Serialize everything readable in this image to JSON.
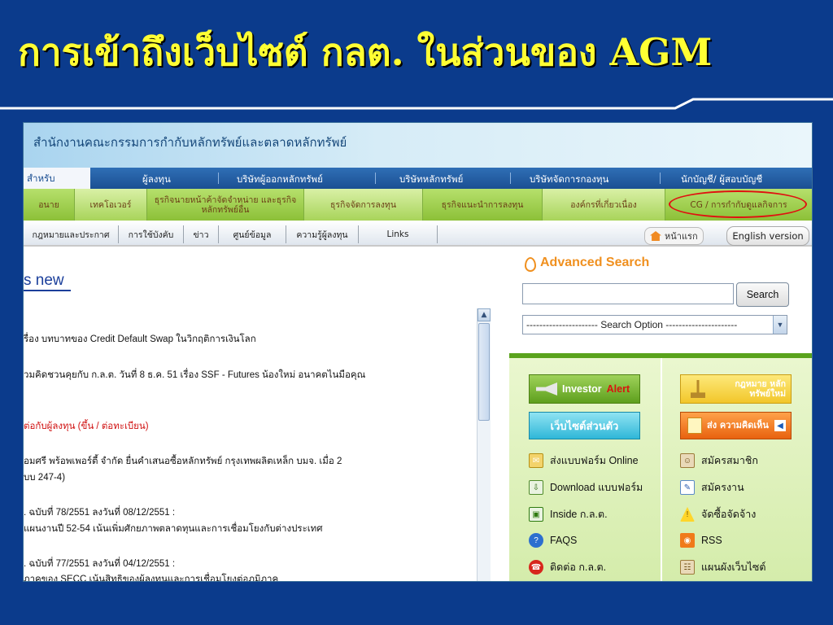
{
  "slide": {
    "title": "การเข้าถึงเว็บไซต์ กลต. ในส่วนของ AGM"
  },
  "site": {
    "banner_title": "สำนักงานคณะกรรมการกำกับหลักทรัพย์และตลาดหลักทรัพย์",
    "nav_primary": [
      "สำหรับ",
      "ผู้ลงทุน",
      "บริษัทผู้ออกหลักทรัพย์",
      "บริษัทหลักทรัพย์",
      "บริษัทจัดการกองทุน",
      "นักบัญชี/ ผู้สอบบัญชี"
    ],
    "nav_secondary": [
      "อนาย",
      "เทคโอเวอร์",
      "ธุรกิจนายหน้าค้าจัดจำหน่าย และธุรกิจหลักทรัพย์อื่น",
      "ธุรกิจจัดการลงทุน",
      "ธุรกิจแนะนำการลงทุน",
      "องค์กรที่เกี่ยวเนื่อง",
      "CG / การกำกับดูแลกิจการ"
    ],
    "nav_tertiary": [
      "กฎหมายและประกาศ",
      "การใช้บังคับ",
      "ข่าว",
      "ศูนย์ข้อมูล",
      "ความรู้ผู้ลงทุน",
      "Links"
    ],
    "home_label": "หน้าแรก",
    "english_label": "English version"
  },
  "news": {
    "heading": "s new",
    "items": [
      "รื่อง บทบาทของ Credit Default Swap ในวิกฤติการเงินโลก",
      "วมคิดชวนคุยกับ ก.ล.ต. วันที่ 8 ธ.ค. 51 เรื่อง SSF - Futures น้องใหม่ อนาคตไนมือคุณ",
      "ต่อกับผู้ลงทุน (ขึ้น / ต่อทะเบียน)",
      "อมศรี พร้อพเพอร์ตี้ จำกัด ยื่นคำเสนอซื้อหลักทรัพย์ กรุงเทพผลิตเหล็ก บมจ. เมื่อ 2",
      "บบ 247-4)",
      ". ฉบับที่ 78/2551 ลงวันที่ 08/12/2551 :",
      "แผนงานปี 52-54 เน้นเพิ่มศักยภาพตลาดทุนและการเชื่อมโยงกับต่างประเทศ",
      ". ฉบับที่ 77/2551 ลงวันที่ 04/12/2551 :",
      "ิภาคของ SECC เน้นสิทธิของผู้ลงทุนและการเชื่อมโยงต่อภูมิภาค"
    ]
  },
  "search": {
    "title": "Advanced Search",
    "button": "Search",
    "option": "---------------------- Search Option ----------------------"
  },
  "panel": {
    "investor_1": "Investor",
    "investor_2": "Alert",
    "website": "เว็บไซต์ส่วนตัว",
    "law": "กฎหมาย หลักทรัพย์ใหม่",
    "feedback": "ส่ง ความคิดเห็น",
    "left_links": [
      "ส่งแบบฟอร์ม Online",
      "Download แบบฟอร์ม",
      "Inside ก.ล.ต.",
      "FAQS",
      "ติดต่อ ก.ล.ต."
    ],
    "right_links": [
      "สมัครสมาชิก",
      "สมัครงาน",
      "จัดซื้อจัดจ้าง",
      "RSS",
      "แผนผังเว็บไซต์"
    ]
  },
  "colors": {
    "slide_bg": "#0b3b8c",
    "title": "#ffff33",
    "highlight": "#e01010"
  }
}
